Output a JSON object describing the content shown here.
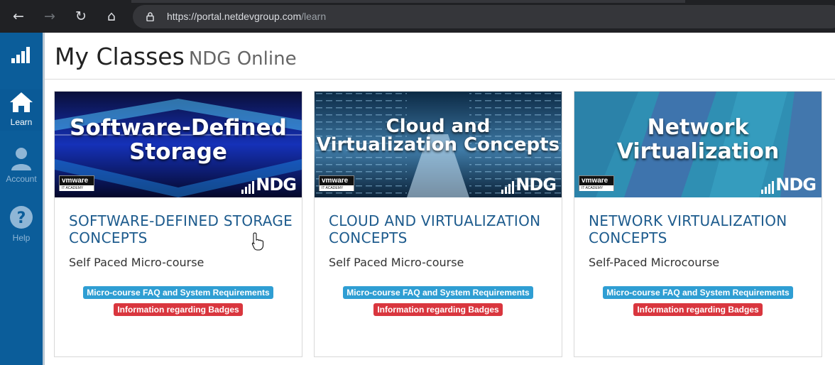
{
  "browser": {
    "url_host": "https://portal.netdevgroup.com",
    "url_path": "/learn",
    "back_icon": "←",
    "forward_icon": "→",
    "reload_icon": "↻",
    "home_icon": "⌂"
  },
  "sidebar": {
    "items": [
      {
        "label": ""
      },
      {
        "label": "Learn"
      },
      {
        "label": "Account"
      },
      {
        "label": "Help"
      }
    ],
    "colors": {
      "background": "#0b5d9a",
      "active": "#ffffff",
      "inactive": "#8fb6d6"
    }
  },
  "header": {
    "title": "My Classes",
    "subtitle": "NDG Online"
  },
  "cards": [
    {
      "image_title_line1": "Software-Defined",
      "image_title_line2": "Storage",
      "title": "SOFTWARE-DEFINED STORAGE CONCEPTS",
      "type": "Self Paced Micro-course",
      "faq_label": "Micro-course FAQ and System Requirements",
      "badges_label": "Information regarding Badges",
      "vm_word": "vmware",
      "vm_sub": "IT ACADEMY",
      "ndg": "NDG"
    },
    {
      "image_title_line1": "Cloud and",
      "image_title_line2": "Virtualization Concepts",
      "title": "CLOUD AND VIRTUALIZATION CONCEPTS",
      "type": "Self Paced Micro-course",
      "faq_label": "Micro-course FAQ and System Requirements",
      "badges_label": "Information regarding Badges",
      "vm_word": "vmware",
      "vm_sub": "IT ACADEMY",
      "ndg": "NDG"
    },
    {
      "image_title_line1": "Network",
      "image_title_line2": "Virtualization",
      "title": "NETWORK VIRTUALIZATION CONCEPTS",
      "type": "Self-Paced Microcourse",
      "faq_label": "Micro-course FAQ and System Requirements",
      "badges_label": "Information regarding Badges",
      "vm_word": "vmware",
      "vm_sub": "IT ACADEMY",
      "ndg": "NDG"
    }
  ],
  "colors": {
    "title_blue": "#1d5b8d",
    "faq_tag": "#2f9ed3",
    "badge_tag": "#d9363e"
  }
}
